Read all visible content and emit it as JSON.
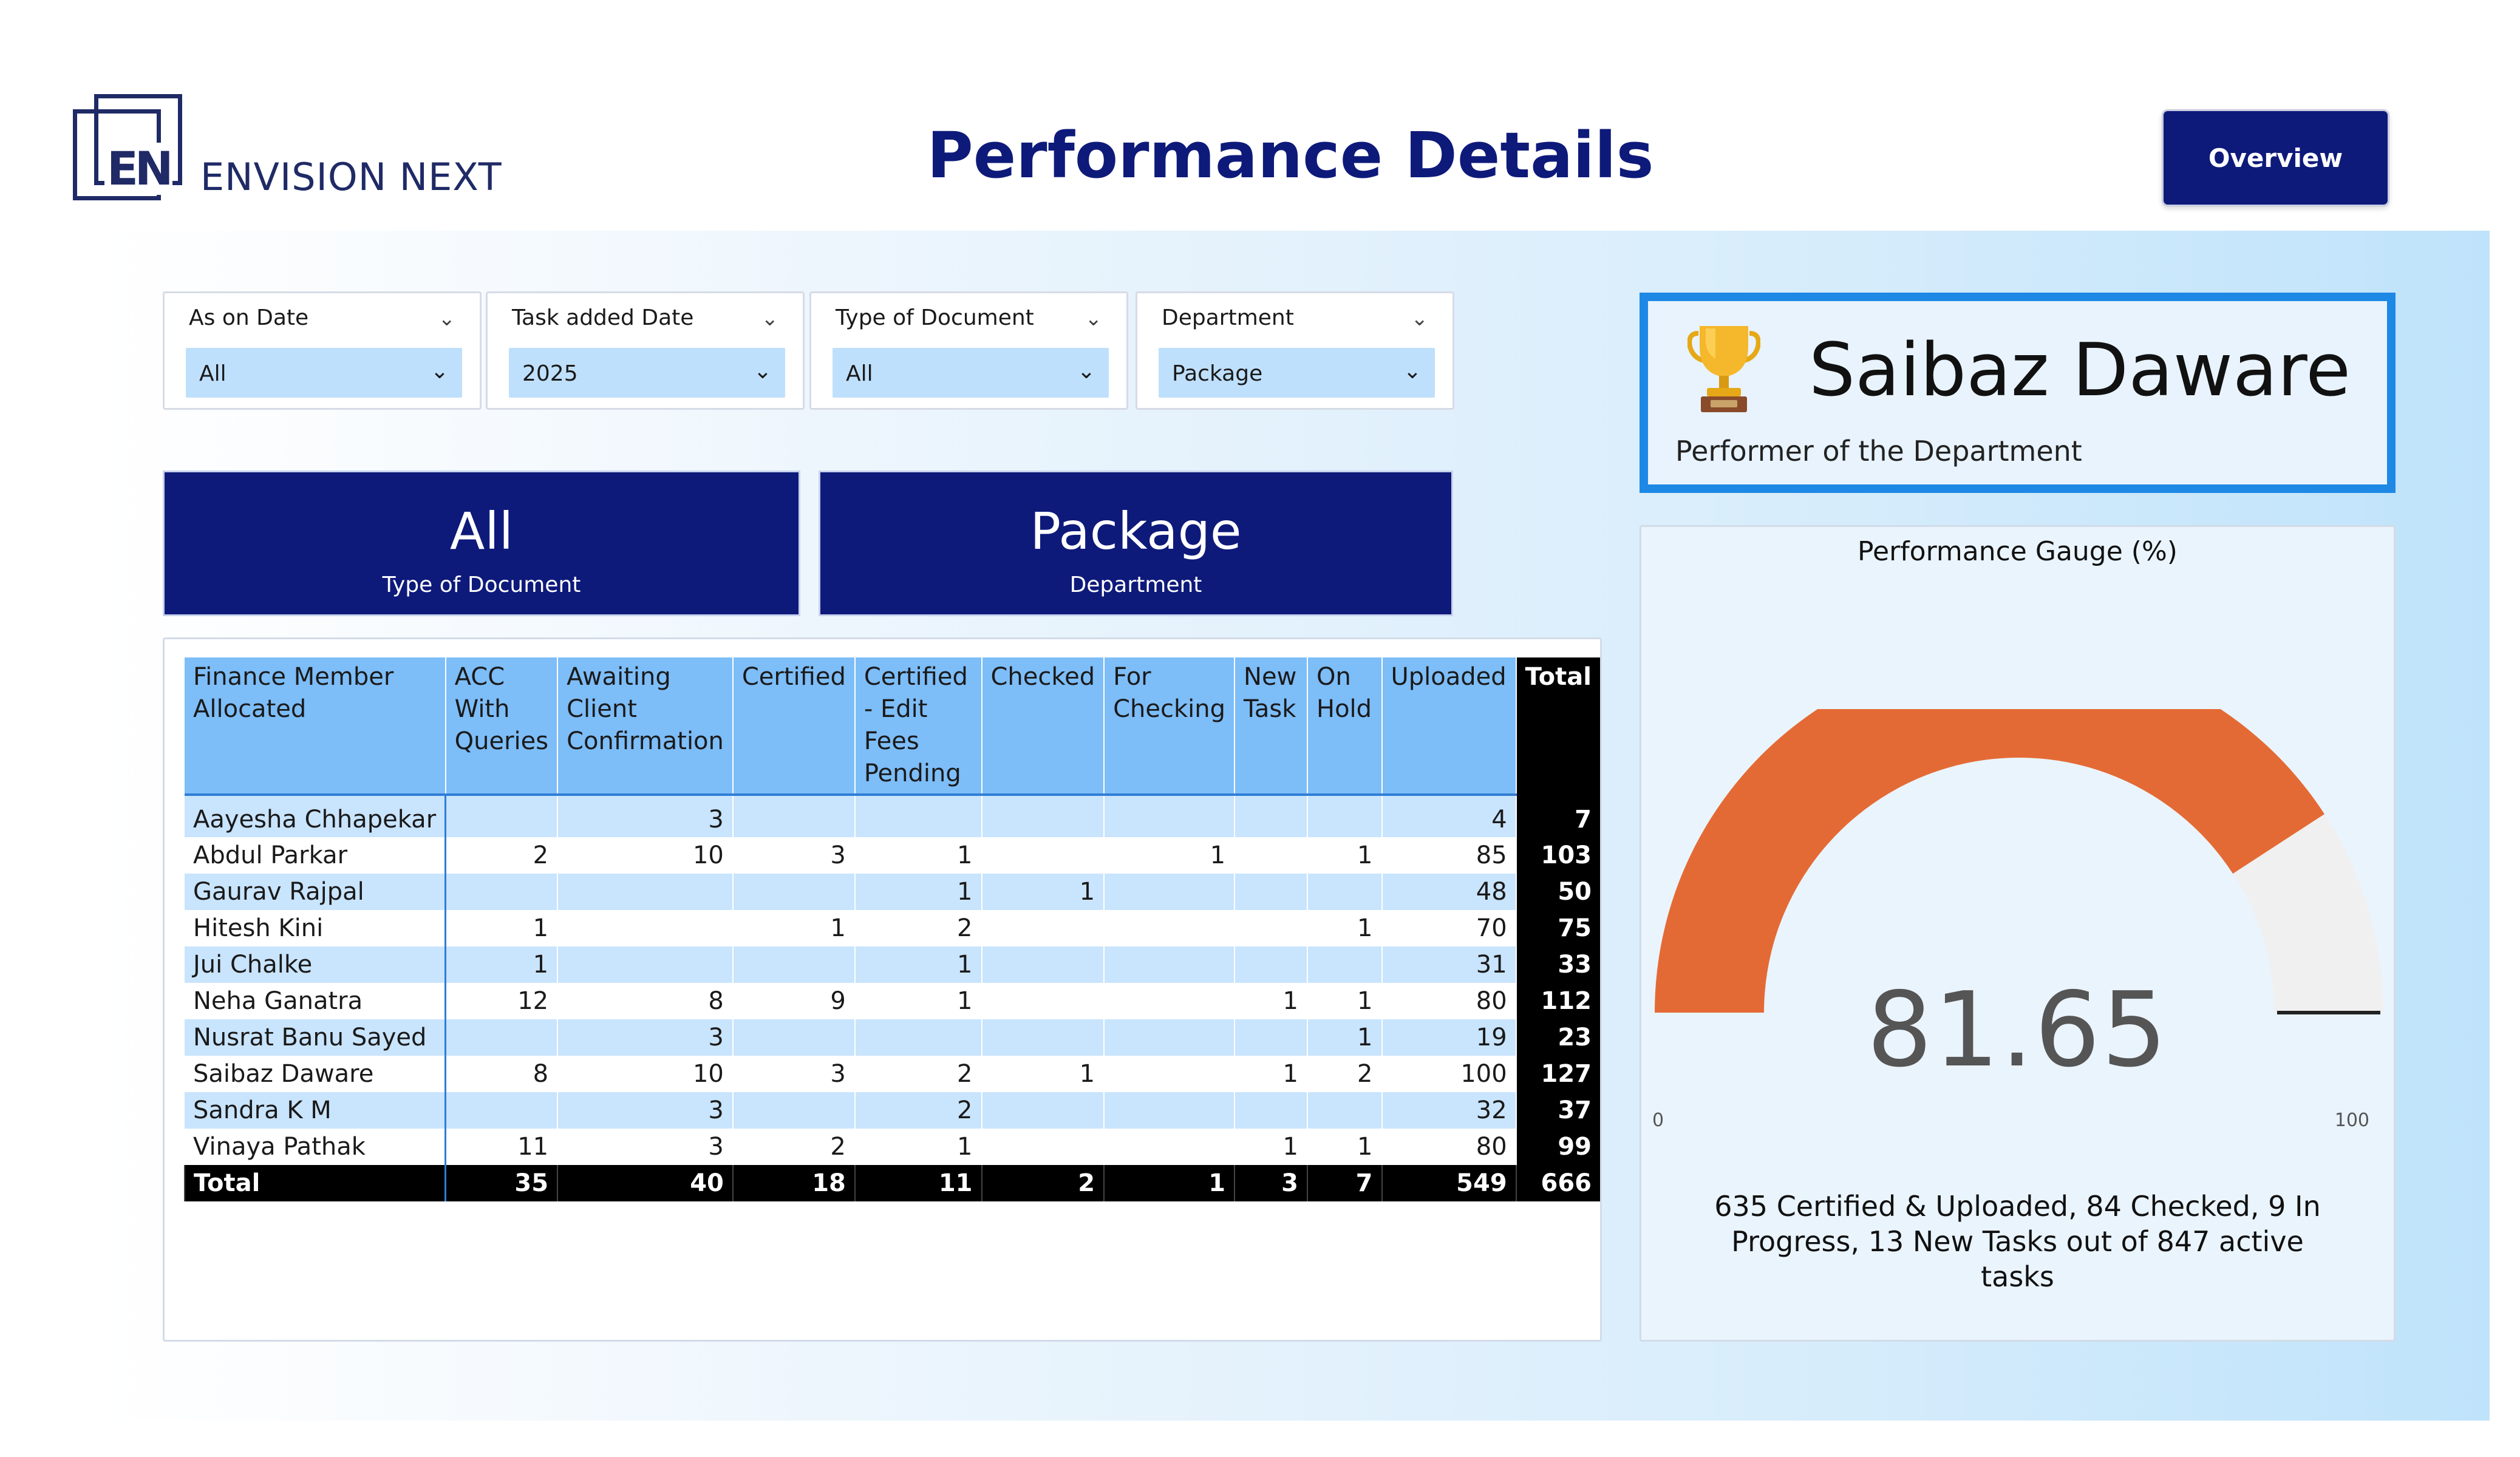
{
  "header": {
    "logo_letters": "EN",
    "logo_name": "ENVISION NEXT",
    "title": "Performance Details",
    "overview_label": "Overview"
  },
  "slicers": [
    {
      "label": "As on Date",
      "value": "All"
    },
    {
      "label": "Task added Date",
      "value": "2025"
    },
    {
      "label": "Type of Document",
      "value": "All"
    },
    {
      "label": "Department",
      "value": "Package"
    }
  ],
  "cards": [
    {
      "value": "All",
      "caption": "Type of Document"
    },
    {
      "value": "Package",
      "caption": "Department"
    }
  ],
  "performer": {
    "name": "Saibaz Daware",
    "subtitle": "Performer of the Department"
  },
  "gauge": {
    "title": "Performance Gauge (%)",
    "value": 81.65,
    "value_label": "81.65",
    "min": "0",
    "max": "100",
    "caption": "635 Certified & Uploaded, 84 Checked, 9 In Progress, 13 New Tasks out of 847 active tasks",
    "fill_color": "#e46a35",
    "track_color": "#f0f0f0"
  },
  "table": {
    "headers": [
      "Finance Member Allocated",
      "ACC With Queries",
      "Awaiting Client Confirmation",
      "Certified",
      "Certified - Edit Fees Pending",
      "Checked",
      "For Checking",
      "New Task",
      "On Hold",
      "Uploaded",
      "Total"
    ],
    "rows": [
      [
        "Aayesha Chhapekar",
        "",
        "3",
        "",
        "",
        "",
        "",
        "",
        "",
        "4",
        "7"
      ],
      [
        "Abdul Parkar",
        "2",
        "10",
        "3",
        "1",
        "",
        "1",
        "",
        "1",
        "85",
        "103"
      ],
      [
        "Gaurav Rajpal",
        "",
        "",
        "",
        "1",
        "1",
        "",
        "",
        "",
        "48",
        "50"
      ],
      [
        "Hitesh Kini",
        "1",
        "",
        "1",
        "2",
        "",
        "",
        "",
        "1",
        "70",
        "75"
      ],
      [
        "Jui Chalke",
        "1",
        "",
        "",
        "1",
        "",
        "",
        "",
        "",
        "31",
        "33"
      ],
      [
        "Neha Ganatra",
        "12",
        "8",
        "9",
        "1",
        "",
        "",
        "1",
        "1",
        "80",
        "112"
      ],
      [
        "Nusrat Banu Sayed",
        "",
        "3",
        "",
        "",
        "",
        "",
        "",
        "1",
        "19",
        "23"
      ],
      [
        "Saibaz Daware",
        "8",
        "10",
        "3",
        "2",
        "1",
        "",
        "1",
        "2",
        "100",
        "127"
      ],
      [
        "Sandra K M",
        "",
        "3",
        "",
        "2",
        "",
        "",
        "",
        "",
        "32",
        "37"
      ],
      [
        "Vinaya Pathak",
        "11",
        "3",
        "2",
        "1",
        "",
        "",
        "1",
        "1",
        "80",
        "99"
      ]
    ],
    "total_row": [
      "Total",
      "35",
      "40",
      "18",
      "11",
      "2",
      "1",
      "3",
      "7",
      "549",
      "666"
    ]
  }
}
